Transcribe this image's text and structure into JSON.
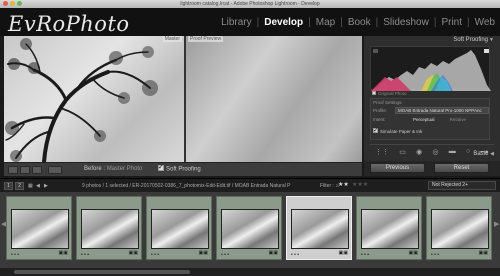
{
  "window": {
    "title": "lightroom catalog.lrcat - Adobe Photoshop Lightroom - Develop"
  },
  "identity_plate": "EvRoPhoto",
  "modules": [
    "Library",
    "Develop",
    "Map",
    "Book",
    "Slideshow",
    "Print",
    "Web"
  ],
  "active_module": "Develop",
  "viewer": {
    "left_label": "Master",
    "right_label": "Proof Preview"
  },
  "toolbar": {
    "before_label": "Before :",
    "before_value": "Master Photo",
    "soft_proofing_label": "Soft Proofing",
    "soft_proofing_checked": true
  },
  "right_panel": {
    "panel_title": "Soft Proofing",
    "original_photo_label": "Original Photo",
    "proof_settings_label": "Proof Settings:",
    "profile_label": "Profile:",
    "profile_value": "MOAB Entrada Natural Pro-1000 NPPAnc",
    "intent_label": "Intent:",
    "intent_perceptual": "Perceptual",
    "intent_relative": "Relative",
    "simulate_label": "Simulate Paper & Ink",
    "basic_label": "Basic",
    "previous_button": "Previous",
    "reset_button": "Reset"
  },
  "filmstrip_header": {
    "tab1": "1",
    "tab2": "2",
    "info": "9 photos / 1 selected / ER-20170502-0386_7_photomix-Edit-Edit.tif / MOAB Entrada Natural P",
    "filter_label": "Filter :",
    "stars": "★★",
    "filter_value": "Not Rejected 2+"
  },
  "filmstrip": {
    "thumb_count": 7,
    "selected_index": 4,
    "thumb_dots": "• • •"
  },
  "colors": {
    "accent": "#ffffff",
    "panel_bg": "#2e2e2e",
    "filmstrip_bg": "#3a3a3a"
  }
}
